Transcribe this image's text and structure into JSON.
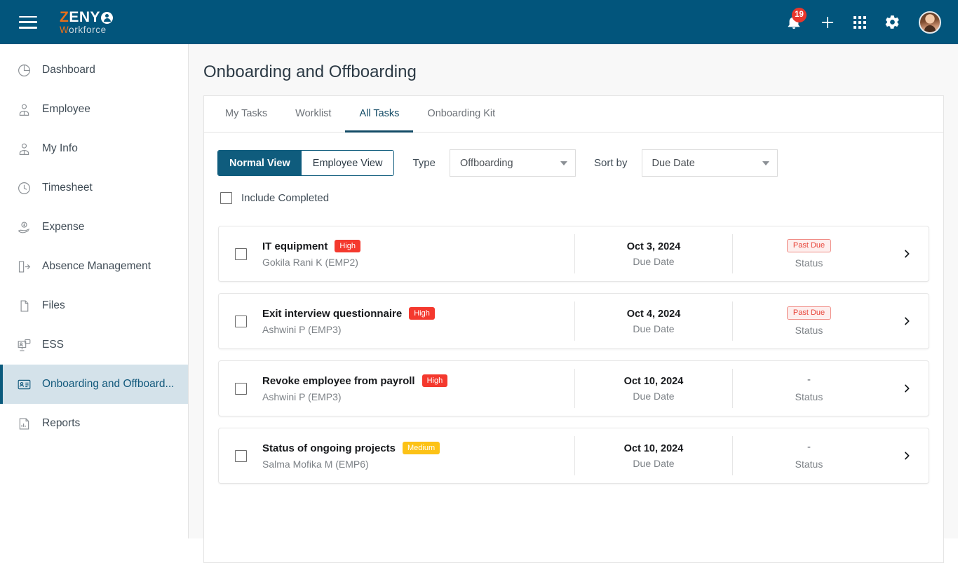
{
  "topbar": {
    "menu_icon": "hamburger-menu-icon",
    "brand": {
      "z": "Z",
      "eny": "ENY",
      "sub_w": "W",
      "sub_rest": "orkforce"
    },
    "notifications_count": "19",
    "icons": [
      "bell-icon",
      "plus-icon",
      "apps-grid-icon",
      "gear-icon",
      "avatar"
    ]
  },
  "sidebar": {
    "items": [
      {
        "label": "Dashboard",
        "icon": "pie-chart-icon",
        "active": false
      },
      {
        "label": "Employee",
        "icon": "employee-icon",
        "active": false
      },
      {
        "label": "My Info",
        "icon": "user-info-icon",
        "active": false
      },
      {
        "label": "Timesheet",
        "icon": "clock-icon",
        "active": false
      },
      {
        "label": "Expense",
        "icon": "expense-hand-icon",
        "active": false
      },
      {
        "label": "Absence Management",
        "icon": "door-exit-icon",
        "active": false
      },
      {
        "label": "Files",
        "icon": "files-icon",
        "active": false
      },
      {
        "label": "ESS",
        "icon": "ess-monitor-icon",
        "active": false
      },
      {
        "label": "Onboarding and Offboard...",
        "icon": "id-card-icon",
        "active": true
      },
      {
        "label": "Reports",
        "icon": "report-chart-icon",
        "active": false
      }
    ]
  },
  "main": {
    "page_title": "Onboarding and Offboarding",
    "tabs": [
      {
        "label": "My Tasks",
        "active": false
      },
      {
        "label": "Worklist",
        "active": false
      },
      {
        "label": "All Tasks",
        "active": true
      },
      {
        "label": "Onboarding Kit",
        "active": false
      }
    ],
    "controls": {
      "view_normal": "Normal View",
      "view_employee": "Employee View",
      "type_label": "Type",
      "type_value": "Offboarding",
      "sort_label": "Sort by",
      "sort_value": "Due Date",
      "include_completed_label": "Include Completed",
      "include_completed_checked": false
    },
    "column_labels": {
      "due": "Due Date",
      "status": "Status"
    },
    "tasks": [
      {
        "title": "IT equipment",
        "priority": "High",
        "priority_level": "high",
        "assignee": "Gokila Rani K (EMP2)",
        "due_date": "Oct 3, 2024",
        "status": "Past Due",
        "status_type": "pill"
      },
      {
        "title": "Exit interview questionnaire",
        "priority": "High",
        "priority_level": "high",
        "assignee": "Ashwini P (EMP3)",
        "due_date": "Oct 4, 2024",
        "status": "Past Due",
        "status_type": "pill"
      },
      {
        "title": "Revoke employee from payroll",
        "priority": "High",
        "priority_level": "high",
        "assignee": "Ashwini P (EMP3)",
        "due_date": "Oct 10, 2024",
        "status": "-",
        "status_type": "dash"
      },
      {
        "title": "Status of ongoing projects",
        "priority": "Medium",
        "priority_level": "medium",
        "assignee": "Salma Mofika M (EMP6)",
        "due_date": "Oct 10, 2024",
        "status": "-",
        "status_type": "dash"
      }
    ]
  },
  "colors": {
    "brand_blue": "#02557c",
    "brand_orange": "#e8701a",
    "accent_teal": "#0f5c7d",
    "high": "#f4392e",
    "medium": "#fcc216",
    "past_due": "#e8453a",
    "active_nav_bg": "#d4e2ea"
  }
}
